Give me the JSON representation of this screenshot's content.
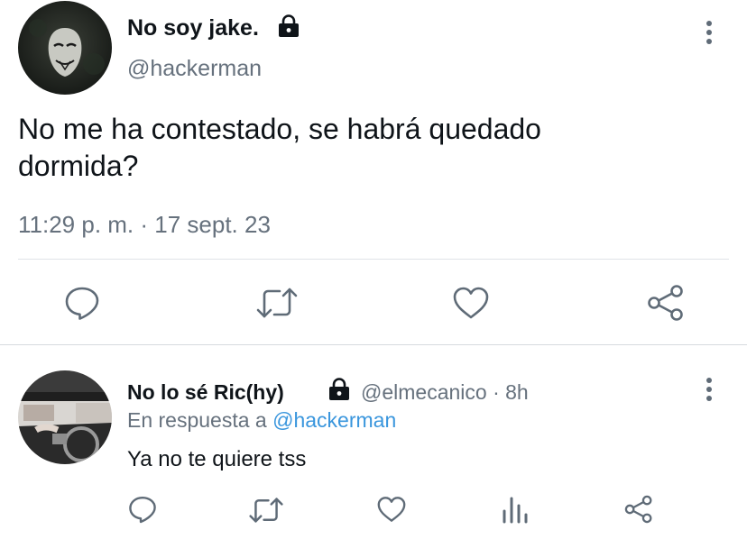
{
  "main_tweet": {
    "display_name": "No soy jake.",
    "handle": "@hackerman",
    "text": "No me ha contestado, se habrá quedado dormida?",
    "timestamp": "11:29 p. m. · 17 sept. 23",
    "icons": {
      "lock": "lock-icon",
      "more": "more-vertical-icon"
    },
    "actions": [
      "reply-icon",
      "retweet-icon",
      "like-icon",
      "share-icon"
    ]
  },
  "reply_tweet": {
    "display_name": "No lo sé Ric(hy)",
    "handle_time": "@elmecanico · 8h",
    "replying_prefix": "En respuesta a",
    "replying_to": "@hackerman",
    "text": "Ya no te quiere tss",
    "icons": {
      "lock": "lock-icon",
      "more": "more-vertical-icon"
    },
    "actions": [
      "reply-icon",
      "retweet-icon",
      "like-icon",
      "analytics-icon",
      "share-icon"
    ]
  },
  "colors": {
    "text": "#0f1419",
    "muted": "#66717d",
    "link": "#3a96dd",
    "divider": "#dfe3e7",
    "icon": "#5f6b77"
  }
}
